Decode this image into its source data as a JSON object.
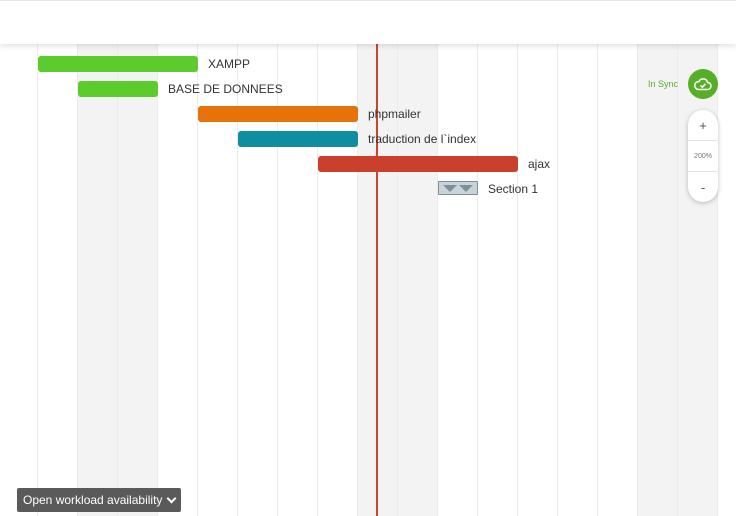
{
  "colors": {
    "green": "#5ccc2d",
    "orange": "#e7720a",
    "teal": "#0f8da1",
    "red": "#c9412c",
    "today_line": "#c8462e",
    "sync_green": "#56b027"
  },
  "tasks": [
    {
      "label": "XAMPP",
      "color": "#5ccc2d"
    },
    {
      "label": "BASE DE DONNEES",
      "color": "#5ccc2d"
    },
    {
      "label": "phpmailer",
      "color": "#e7720a"
    },
    {
      "label": "traduction de l`index",
      "color": "#0f8da1"
    },
    {
      "label": "ajax",
      "color": "#c9412c"
    }
  ],
  "section": {
    "label": "Section 1",
    "icon": "collapse-arrows-icon"
  },
  "sync": {
    "label": "In Sync",
    "icon": "cloud-check-icon"
  },
  "zoom": {
    "plus": "+",
    "level": "200%",
    "minus": "-"
  },
  "workload": {
    "label": "Open workload availability",
    "icon": "chevron-down-icon"
  }
}
